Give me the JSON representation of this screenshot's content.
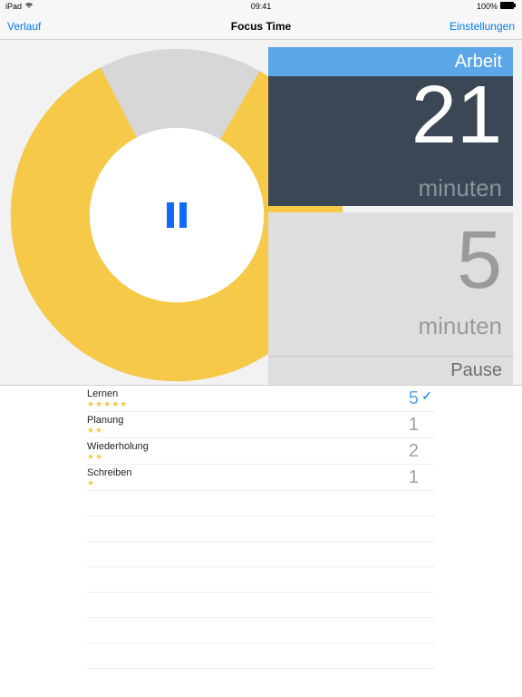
{
  "statusbar": {
    "device": "iPad",
    "time": "09:41",
    "battery_pct": "100%"
  },
  "nav": {
    "left": "Verlauf",
    "title": "Focus Time",
    "right": "Einstellungen"
  },
  "timer": {
    "work": {
      "label": "Arbeit",
      "value": "21",
      "unit": "minuten"
    },
    "break": {
      "label": "Pause",
      "value": "5",
      "unit": "minuten"
    },
    "progress_fraction": 0.84
  },
  "tasks": [
    {
      "name": "Lernen",
      "stars": 5,
      "max_stars": 5,
      "count": "5",
      "selected": true
    },
    {
      "name": "Planung",
      "stars": 2,
      "max_stars": 5,
      "count": "1",
      "selected": false
    },
    {
      "name": "Wiederholung",
      "stars": 2,
      "max_stars": 5,
      "count": "2",
      "selected": false
    },
    {
      "name": "Schreiben",
      "stars": 1,
      "max_stars": 5,
      "count": "1",
      "selected": false
    }
  ],
  "chart_data": {
    "type": "pie",
    "title": "",
    "series": [
      {
        "name": "elapsed",
        "value": 84,
        "color": "#f7c948"
      },
      {
        "name": "remaining",
        "value": 16,
        "color": "#d7d7d7"
      }
    ]
  },
  "colors": {
    "accent": "#007aff",
    "yellow": "#f7c948",
    "work_header": "#5aa6e6",
    "work_body": "#3b4754",
    "break_body": "#dedede"
  }
}
